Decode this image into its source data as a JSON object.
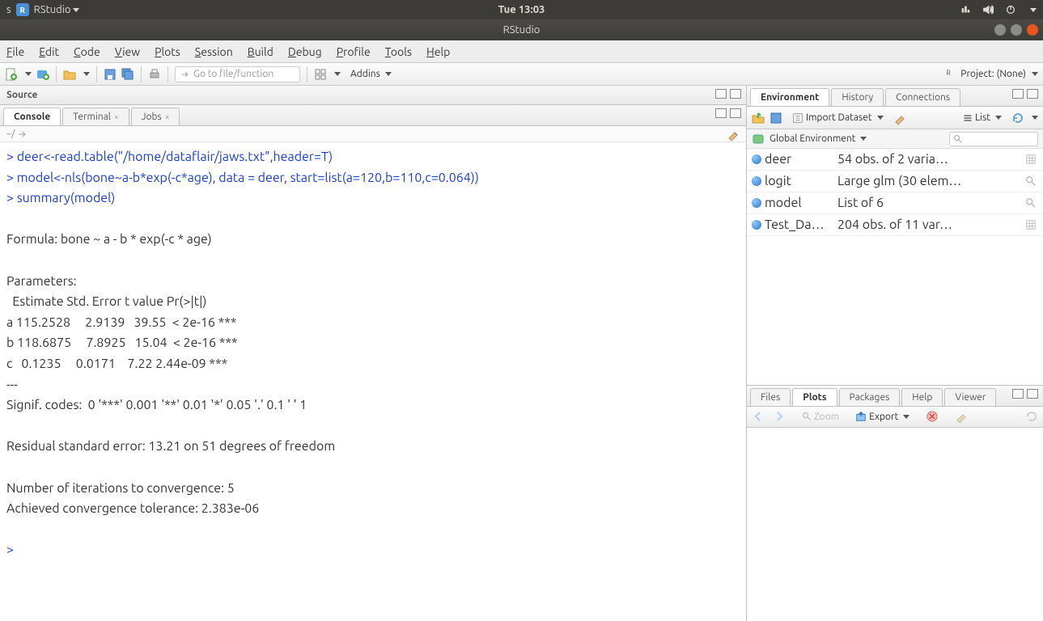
{
  "ubuntu": {
    "app": "RStudio",
    "clock": "Tue 13:03"
  },
  "window": {
    "title": "RStudio"
  },
  "menu": {
    "file": "File",
    "edit": "Edit",
    "code": "Code",
    "view": "View",
    "plots": "Plots",
    "session": "Session",
    "build": "Build",
    "debug": "Debug",
    "profile": "Profile",
    "tools": "Tools",
    "help": "Help"
  },
  "toolbar": {
    "goto_placeholder": "Go to file/function",
    "addins": "Addins",
    "project_label": "Project: (None)"
  },
  "source": {
    "title": "Source"
  },
  "console_tabs": {
    "console": "Console",
    "terminal": "Terminal",
    "jobs": "Jobs"
  },
  "console": {
    "path": "~/",
    "lines": [
      {
        "t": "cmd",
        "text": "> deer<-read.table(\"/home/dataflair/jaws.txt\",header=T)"
      },
      {
        "t": "cmd",
        "text": "> model<-nls(bone~a-b*exp(-c*age), data = deer, start=list(a=120,b=110,c=0.064))"
      },
      {
        "t": "cmd",
        "text": "> summary(model)"
      },
      {
        "t": "out",
        "text": ""
      },
      {
        "t": "out",
        "text": "Formula: bone ~ a - b * exp(-c * age)"
      },
      {
        "t": "out",
        "text": ""
      },
      {
        "t": "out",
        "text": "Parameters:"
      },
      {
        "t": "out",
        "text": "  Estimate Std. Error t value Pr(>|t|)    "
      },
      {
        "t": "out",
        "text": "a 115.2528     2.9139   39.55  < 2e-16 ***"
      },
      {
        "t": "out",
        "text": "b 118.6875     7.8925   15.04  < 2e-16 ***"
      },
      {
        "t": "out",
        "text": "c   0.1235     0.0171    7.22 2.44e-09 ***"
      },
      {
        "t": "out",
        "text": "---"
      },
      {
        "t": "out",
        "text": "Signif. codes:  0 '***' 0.001 '**' 0.01 '*' 0.05 '.' 0.1 ' ' 1"
      },
      {
        "t": "out",
        "text": ""
      },
      {
        "t": "out",
        "text": "Residual standard error: 13.21 on 51 degrees of freedom"
      },
      {
        "t": "out",
        "text": ""
      },
      {
        "t": "out",
        "text": "Number of iterations to convergence: 5 "
      },
      {
        "t": "out",
        "text": "Achieved convergence tolerance: 2.383e-06"
      },
      {
        "t": "out",
        "text": ""
      },
      {
        "t": "prompt",
        "text": "> "
      }
    ]
  },
  "env_tabs": {
    "environment": "Environment",
    "history": "History",
    "connections": "Connections"
  },
  "env_toolbar": {
    "import": "Import Dataset",
    "list": "List",
    "global": "Global Environment"
  },
  "env_rows": [
    {
      "name": "deer",
      "desc": "54 obs. of 2 varia…",
      "icon": "table"
    },
    {
      "name": "logit",
      "desc": "Large glm (30 elem…",
      "icon": "search"
    },
    {
      "name": "model",
      "desc": "List of 6",
      "icon": "search"
    },
    {
      "name": "Test_Da…",
      "desc": "204 obs. of 11 var…",
      "icon": "table"
    }
  ],
  "lower_tabs": {
    "files": "Files",
    "plots": "Plots",
    "packages": "Packages",
    "help": "Help",
    "viewer": "Viewer"
  },
  "plots_toolbar": {
    "zoom": "Zoom",
    "export": "Export"
  }
}
